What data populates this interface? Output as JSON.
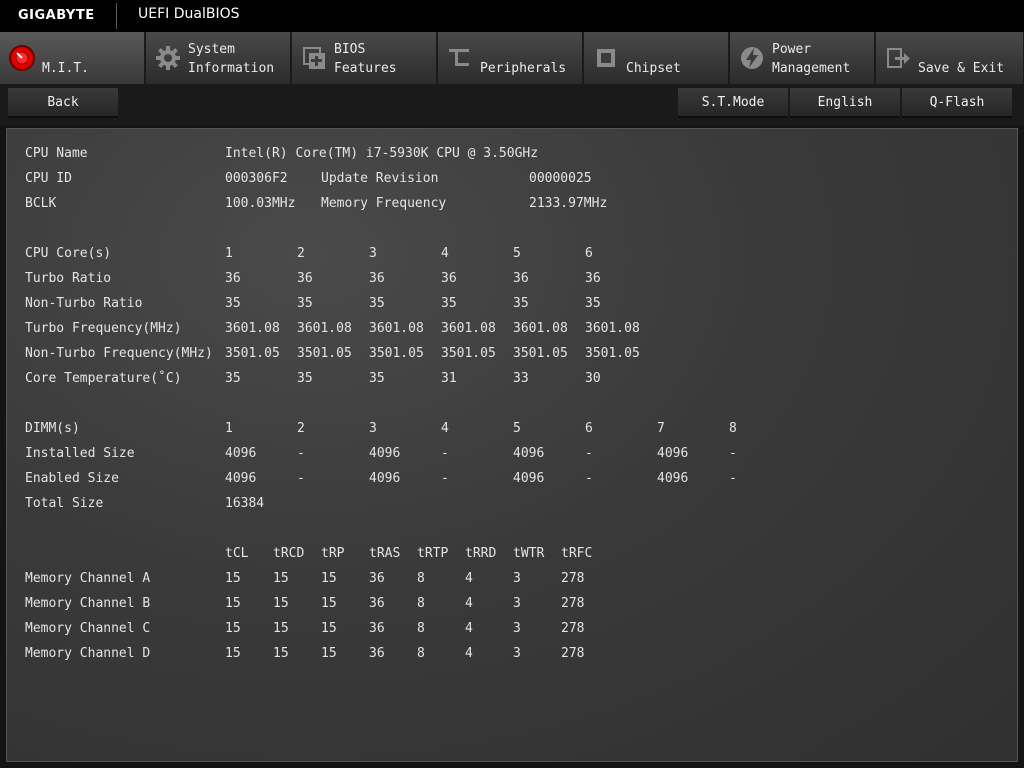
{
  "header": {
    "brand": "GIGABYTE",
    "product": "UEFI DualBIOS"
  },
  "tabs": [
    {
      "line1": "M.I.T.",
      "line2": "",
      "icon": "mit-icon",
      "active": true
    },
    {
      "line1": "System",
      "line2": "Information",
      "icon": "gear-icon",
      "active": false
    },
    {
      "line1": "BIOS",
      "line2": "Features",
      "icon": "bios-features-icon",
      "active": false
    },
    {
      "line1": "Peripherals",
      "line2": "",
      "icon": "peripherals-icon",
      "active": false
    },
    {
      "line1": "Chipset",
      "line2": "",
      "icon": "chip-icon",
      "active": false
    },
    {
      "line1": "Power",
      "line2": "Management",
      "icon": "power-icon",
      "active": false
    },
    {
      "line1": "Save & Exit",
      "line2": "",
      "icon": "exit-icon",
      "active": false
    }
  ],
  "toolbar": {
    "back": "Back",
    "stmode": "S.T.Mode",
    "language": "English",
    "qflash": "Q-Flash"
  },
  "cpu": {
    "name_label": "CPU Name",
    "name_value": "Intel(R) Core(TM) i7-5930K CPU @ 3.50GHz",
    "id_label": "CPU ID",
    "id_value": "000306F2",
    "update_rev_label": "Update Revision",
    "update_rev_value": "00000025",
    "bclk_label": "BCLK",
    "bclk_value": "100.03MHz",
    "mem_freq_label": "Memory Frequency",
    "mem_freq_value": "2133.97MHz"
  },
  "cores": {
    "header_label": "CPU Core(s)",
    "headers": [
      "1",
      "2",
      "3",
      "4",
      "5",
      "6"
    ],
    "rows": [
      {
        "label": "Turbo Ratio",
        "values": [
          "36",
          "36",
          "36",
          "36",
          "36",
          "36"
        ]
      },
      {
        "label": "Non-Turbo Ratio",
        "values": [
          "35",
          "35",
          "35",
          "35",
          "35",
          "35"
        ]
      },
      {
        "label": "Turbo Frequency(MHz)",
        "values": [
          "3601.08",
          "3601.08",
          "3601.08",
          "3601.08",
          "3601.08",
          "3601.08"
        ]
      },
      {
        "label": "Non-Turbo Frequency(MHz)",
        "values": [
          "3501.05",
          "3501.05",
          "3501.05",
          "3501.05",
          "3501.05",
          "3501.05"
        ]
      },
      {
        "label": "Core Temperature(˚C)",
        "values": [
          "35",
          "35",
          "35",
          "31",
          "33",
          "30"
        ]
      }
    ]
  },
  "dimms": {
    "header_label": "DIMM(s)",
    "headers": [
      "1",
      "2",
      "3",
      "4",
      "5",
      "6",
      "7",
      "8"
    ],
    "rows": [
      {
        "label": "Installed Size",
        "values": [
          "4096",
          "-",
          "4096",
          "-",
          "4096",
          "-",
          "4096",
          "-"
        ]
      },
      {
        "label": "Enabled Size",
        "values": [
          "4096",
          "-",
          "4096",
          "-",
          "4096",
          "-",
          "4096",
          "-"
        ]
      }
    ],
    "total_label": "Total Size",
    "total_value": "16384"
  },
  "timings": {
    "headers": [
      "tCL",
      "tRCD",
      "tRP",
      "tRAS",
      "tRTP",
      "tRRD",
      "tWTR",
      "tRFC"
    ],
    "rows": [
      {
        "label": "Memory Channel A",
        "values": [
          "15",
          "15",
          "15",
          "36",
          "8",
          "4",
          "3",
          "278"
        ]
      },
      {
        "label": "Memory Channel B",
        "values": [
          "15",
          "15",
          "15",
          "36",
          "8",
          "4",
          "3",
          "278"
        ]
      },
      {
        "label": "Memory Channel C",
        "values": [
          "15",
          "15",
          "15",
          "36",
          "8",
          "4",
          "3",
          "278"
        ]
      },
      {
        "label": "Memory Channel D",
        "values": [
          "15",
          "15",
          "15",
          "36",
          "8",
          "4",
          "3",
          "278"
        ]
      }
    ]
  },
  "colors": {
    "accent_red": "#e00000",
    "panel": "#3a3a3a",
    "topbar": "#000000"
  }
}
